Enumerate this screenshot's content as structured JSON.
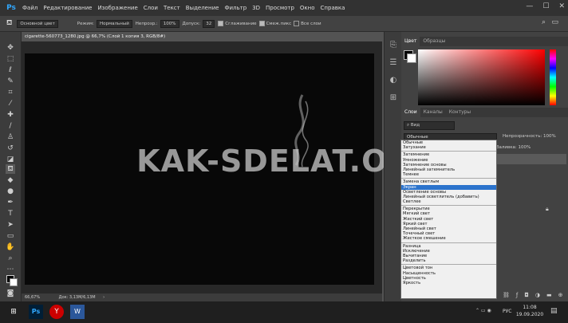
{
  "menubar": {
    "logo": "Ps",
    "items": [
      "Файл",
      "Редактирование",
      "Изображение",
      "Слои",
      "Текст",
      "Выделение",
      "Фильтр",
      "3D",
      "Просмотр",
      "Окно",
      "Справка"
    ],
    "window_controls": [
      "—",
      "☐",
      "✕"
    ]
  },
  "options": {
    "source": "Основной цвет",
    "mode_label": "Режим:",
    "mode_value": "Нормальный",
    "opacity_label": "Непрозр.:",
    "opacity_value": "100%",
    "tolerance_label": "Допуск:",
    "tolerance_value": "32",
    "antialias_label": "Сглаживание",
    "contiguous_label": "Смеж.пикс",
    "all_layers_label": "Все слои"
  },
  "document": {
    "tab_title": "cigarette-560773_1280.jpg @ 66,7% (Слой 1 копия 3, RGB/8#) *",
    "zoom": "66,67%",
    "doc_size": "Док: 3,13M/6,13M"
  },
  "watermark": "KAK-SDELAT.ORG",
  "color_panel": {
    "tabs": [
      "Цвет",
      "Образцы"
    ]
  },
  "layers_panel": {
    "tabs": [
      "Слои",
      "Каналы",
      "Контуры"
    ],
    "filter_label": "Вид",
    "blend_value": "Обычные",
    "opacity_label": "Непрозрачность:",
    "opacity_value": "100%",
    "fill_label": "Заливка:",
    "fill_value": "100%"
  },
  "blend_groups": [
    [
      "Обычные",
      "Затухание"
    ],
    [
      "Затемнение",
      "Умножение",
      "Затемнение основы",
      "Линейный затемнитель",
      "Темнее"
    ],
    [
      "Замена светлым",
      "Экран",
      "Осветление основы",
      "Линейный осветлитель (добавить)",
      "Светлее"
    ],
    [
      "Перекрытие",
      "Мягкий свет",
      "Жесткий свет",
      "Яркий свет",
      "Линейный свет",
      "Точечный свет",
      "Жесткое смешение"
    ],
    [
      "Разница",
      "Исключение",
      "Вычитание",
      "Разделить"
    ],
    [
      "Цветовой тон",
      "Насыщенность",
      "Цветность",
      "Яркость"
    ]
  ],
  "blend_selected": "Экран",
  "taskbar": {
    "time": "11:08",
    "date": "19.09.2020",
    "lang": "РУС"
  }
}
